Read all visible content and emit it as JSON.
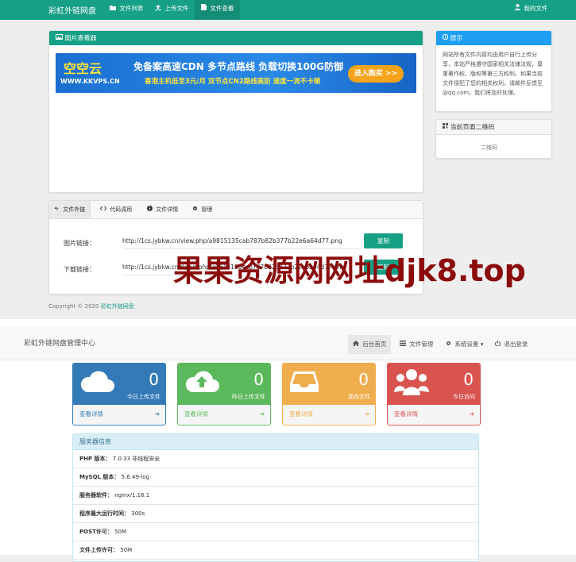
{
  "top_nav": {
    "brand": "彩虹外链网盘",
    "items": [
      {
        "label": "文件列表",
        "icon": "folder-icon"
      },
      {
        "label": "上传文件",
        "icon": "upload-icon"
      },
      {
        "label": "文件查看",
        "icon": "file-icon",
        "active": true
      }
    ],
    "my_files": "我的文件"
  },
  "viewer": {
    "title": "图片查看器",
    "banner": {
      "logo": "空空云",
      "site": "WWW.KKVPS.CN",
      "headline": "免备案高速CDN 多节点路线 负载切换100G防御",
      "subline": "香港主机低至3元/月 双节点CN2路线高防 速度一流不卡顿",
      "button": "进入购买 >>"
    }
  },
  "tip": {
    "title": "提示",
    "text": "网站所有文件内容均由用户自行上传分享，本站严格遵守国家相关法律法规，尊重著作权、版权等第三方权利。如果当前文件侵犯了您的相关权利，请邮件反馈至@qq.com，我们将及时处理。"
  },
  "qr": {
    "title": "当前页面二维码",
    "alt": "二维码"
  },
  "tabs": [
    {
      "label": "文件外链",
      "icon": "link-icon",
      "active": true
    },
    {
      "label": "代码调用",
      "icon": "code-icon"
    },
    {
      "label": "文件详情",
      "icon": "info-icon"
    },
    {
      "label": "管理",
      "icon": "gear-icon"
    }
  ],
  "links": {
    "image_label": "图片链接：",
    "image_url": "http://1cs.jybkw.cn/view.php/a9815135cab787b82b377b22e6a64d77.png",
    "download_label": "下载链接：",
    "download_url": "http://1cs.jybkw.cn/down.php/a9815135cab787b82b377b22e6a64d77.png",
    "copy_label": "复制"
  },
  "copyright": {
    "prefix": "Copyright © 2020 ",
    "link": "彩虹外链网盘"
  },
  "watermark": "果果资源网网址djk8.top",
  "admin": {
    "brand": "彩虹外链网盘管理中心",
    "nav": [
      {
        "label": "后台首页",
        "icon": "home-icon",
        "active": true
      },
      {
        "label": "文件管理",
        "icon": "list-icon"
      },
      {
        "label": "系统设置",
        "icon": "gear-icon",
        "dropdown": true
      },
      {
        "label": "退出登录",
        "icon": "power-icon"
      }
    ],
    "cards": [
      {
        "value": "0",
        "label": "今日上传文件",
        "footer": "查看详情",
        "color": "#337ab7",
        "icon": "cloud-icon"
      },
      {
        "value": "0",
        "label": "昨日上传文件",
        "footer": "查看详情",
        "color": "#5cb85c",
        "icon": "cloud-upload-icon"
      },
      {
        "value": "0",
        "label": "现存文件",
        "footer": "查看详情",
        "color": "#f0ad4e",
        "icon": "inbox-icon"
      },
      {
        "value": "0",
        "label": "今日访问",
        "footer": "查看详情",
        "color": "#d9534f",
        "icon": "users-icon"
      }
    ],
    "server": {
      "title": "服务器信息",
      "rows": [
        {
          "key": "PHP 版本：",
          "value": "7.0.33 非线程安全"
        },
        {
          "key": "MySQL 版本：",
          "value": "5.6.49-log"
        },
        {
          "key": "服务器软件：",
          "value": "nginx/1.16.1"
        },
        {
          "key": "程序最大运行时间：",
          "value": "300s"
        },
        {
          "key": "POST许可：",
          "value": "50M"
        },
        {
          "key": "文件上传许可：",
          "value": "50M"
        }
      ]
    }
  }
}
